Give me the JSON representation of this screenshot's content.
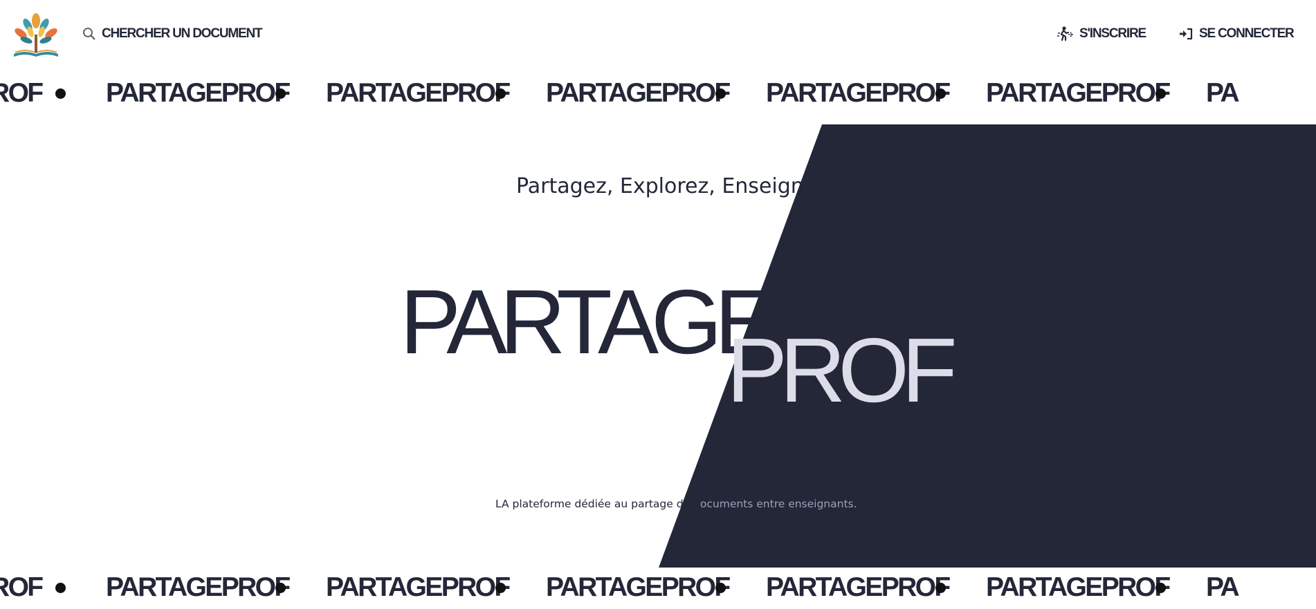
{
  "header": {
    "search_label": "CHERCHER UN DOCUMENT",
    "register_label": "S'INSCRIRE",
    "login_label": "SE CONNECTER"
  },
  "marquee": {
    "word": "PARTAGEPROF",
    "leading_fragment": "ROF",
    "trailing_fragment": "PA"
  },
  "hero": {
    "tagline": "Partagez, Explorez, Enseignez",
    "title_part1": "PARTAGE",
    "title_part2": "PROF",
    "subtitle_part1": "LA plateforme dédiée au partage de d",
    "subtitle_part2": "ocuments entre enseignants."
  },
  "colors": {
    "navy": "#232738",
    "light_text": "#dcdde8",
    "white": "#ffffff"
  },
  "icons": {
    "logo": "tree-book-logo",
    "search": "search-icon",
    "register": "person-walking-icon",
    "login": "sign-in-icon"
  }
}
